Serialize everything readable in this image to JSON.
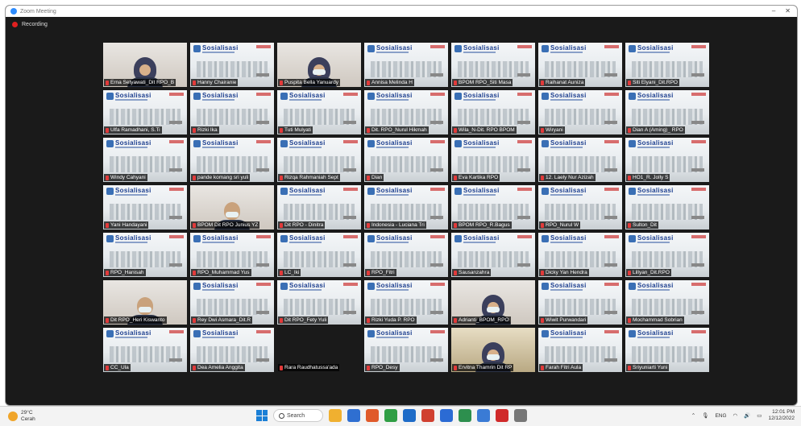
{
  "window": {
    "title": "Zoom Meeting",
    "recording_label": "Recording"
  },
  "slide": {
    "title": "Sosialisasi"
  },
  "participants": [
    {
      "name": "Erna Setyawati_Dit RPO_B",
      "kind": "cam",
      "cam": "light",
      "hijab": true,
      "mask": false
    },
    {
      "name": "Hanny Chairanie",
      "kind": "slide"
    },
    {
      "name": "Puspita Bella Yanuardy",
      "kind": "cam",
      "cam": "light",
      "hijab": true,
      "mask": true
    },
    {
      "name": "Annisa Melinda H",
      "kind": "slide"
    },
    {
      "name": "BPOM RPO_Siti Masa",
      "kind": "slide"
    },
    {
      "name": "Raihanat Auniza",
      "kind": "slide"
    },
    {
      "name": "Siti Elyani_Dit.RPO",
      "kind": "slide"
    },
    {
      "name": "Ulfa Ramadhani, S.Ti",
      "kind": "slide"
    },
    {
      "name": "Rizki Ika",
      "kind": "slide"
    },
    {
      "name": "Tuti Mulyati",
      "kind": "slide"
    },
    {
      "name": "Dit. RPO_Nurul Hikmah",
      "kind": "slide"
    },
    {
      "name": "Wila_N-Dit. RPO BPOM",
      "kind": "slide"
    },
    {
      "name": "Wiryani",
      "kind": "slide"
    },
    {
      "name": "Dian A (Aming)_ RPO",
      "kind": "slide"
    },
    {
      "name": "Windy Cahyani",
      "kind": "slide"
    },
    {
      "name": "pande komang sri yuli",
      "kind": "slide"
    },
    {
      "name": "Rizqa Rahmaniah Sept",
      "kind": "slide"
    },
    {
      "name": "Dian",
      "kind": "slide"
    },
    {
      "name": "Eva Kartika RPO",
      "kind": "slide"
    },
    {
      "name": "12. Laely Nur Azizah",
      "kind": "slide"
    },
    {
      "name": "HO1_R. Jolly S",
      "kind": "slide"
    },
    {
      "name": "Yani Handayani",
      "kind": "slide"
    },
    {
      "name": "BPOM Dit RPO Junius YZ",
      "kind": "cam",
      "cam": "light",
      "hijab": false,
      "mask": true
    },
    {
      "name": "Dit RPO - Dinitra",
      "kind": "slide"
    },
    {
      "name": "Indonesia - Luciana Tri",
      "kind": "slide"
    },
    {
      "name": "BPOM RPO_R.Bagus",
      "kind": "slide"
    },
    {
      "name": "RPO_Nurul W",
      "kind": "slide"
    },
    {
      "name": "Sulton_Dit",
      "kind": "slide"
    },
    {
      "name": "RPO_Hanisah",
      "kind": "slide"
    },
    {
      "name": "RPO_Muhammad Yus",
      "kind": "slide"
    },
    {
      "name": "LC_Iki",
      "kind": "slide"
    },
    {
      "name": "RPO_Fitri",
      "kind": "slide"
    },
    {
      "name": "Sausanzahra",
      "kind": "slide"
    },
    {
      "name": "Dicky Yan Hendra",
      "kind": "slide"
    },
    {
      "name": "Lillyan_Dit.RPO",
      "kind": "slide"
    },
    {
      "name": "Dit RPO_Heri Kiswanto",
      "kind": "cam",
      "cam": "light",
      "hijab": false,
      "mask": true
    },
    {
      "name": "Rey Dwi Asmara_Dit.R",
      "kind": "slide"
    },
    {
      "name": "Dit RPO_Fety Yuli",
      "kind": "slide"
    },
    {
      "name": "Rizki Yuda P. RPO",
      "kind": "slide"
    },
    {
      "name": "Adrianti_BPOM_RPO",
      "kind": "cam",
      "cam": "light",
      "hijab": true,
      "mask": true,
      "active": true
    },
    {
      "name": "Wiwit Purwandari",
      "kind": "slide"
    },
    {
      "name": "Mochammad Sobrian",
      "kind": "slide"
    },
    {
      "name": "CC_Ula",
      "kind": "slide"
    },
    {
      "name": "Dea Amelia Anggita",
      "kind": "slide"
    },
    {
      "name": "Rara Raudhatussa'ada",
      "kind": "empty"
    },
    {
      "name": "RPO_Desy",
      "kind": "slide"
    },
    {
      "name": "Ervitna Thamrin Dit RP",
      "kind": "cam",
      "cam": "warm",
      "hijab": true,
      "mask": true
    },
    {
      "name": "Farah Fitri Aula",
      "kind": "slide"
    },
    {
      "name": "Sriyuniarti Yuni",
      "kind": "slide"
    }
  ],
  "taskbar": {
    "temperature": "29°C",
    "weather": "Cerah",
    "search_label": "Search",
    "language": "ENG",
    "time": "12:01 PM",
    "date": "12/12/2022",
    "app_colors": [
      "#f0b030",
      "#2f6fd1",
      "#e05a2a",
      "#2f9e44",
      "#1e6cc8",
      "#d04030",
      "#2b6bd4",
      "#2d8f4e",
      "#3a7bd5",
      "#d02a2a",
      "#777777"
    ]
  }
}
